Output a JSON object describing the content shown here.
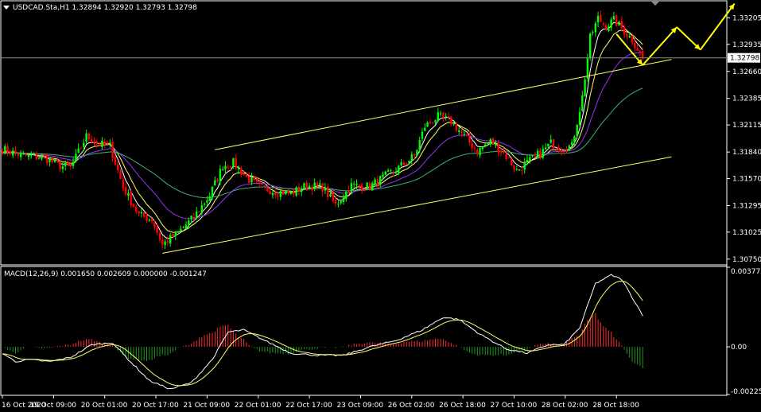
{
  "symbol_info": "USDCAD.Sta,H1  1.32894 1.32920 1.32793 1.32798",
  "current_price": "1.32798",
  "colors": {
    "background": "#000000",
    "bull": "#00ff00",
    "bear": "#ff0000",
    "ma_fast": "#ffffff",
    "ma_mid": "#ffff66",
    "ma_slow": "#9b30ff",
    "ma_long": "#3cb371",
    "channel": "#ffff66",
    "forecast": "#ffff00",
    "macd_hist_pos": "#ff2a2a",
    "macd_hist_neg": "#1f9a1f",
    "macd_main": "#ffffff",
    "macd_signal": "#ffff66",
    "price_marker_bg": "#ffffff",
    "price_marker_text": "#000000"
  },
  "chart_data": [
    {
      "type": "candlestick",
      "title": "USDCAD.Sta,H1  1.32894 1.32920 1.32793 1.32798",
      "x_ticks": [
        "16 Oct 2020",
        "19 Oct 09:00",
        "20 Oct 01:00",
        "20 Oct 17:00",
        "21 Oct 09:00",
        "22 Oct 01:00",
        "22 Oct 17:00",
        "23 Oct 09:00",
        "26 Oct 02:00",
        "26 Oct 18:00",
        "27 Oct 10:00",
        "28 Oct 02:00",
        "28 Oct 18:00"
      ],
      "y_ticks": [
        "1.33205",
        "1.32935",
        "1.32660",
        "1.32385",
        "1.32115",
        "1.31840",
        "1.31570",
        "1.31295",
        "1.31025",
        "1.30750"
      ],
      "ylim": [
        1.307,
        1.3337
      ],
      "last_price": 1.32798,
      "closes_anchor_points": [
        [
          0,
          1.3187
        ],
        [
          8,
          1.318
        ],
        [
          16,
          1.3178
        ],
        [
          22,
          1.317
        ],
        [
          26,
          1.3168
        ],
        [
          32,
          1.32
        ],
        [
          37,
          1.3192
        ],
        [
          41,
          1.319
        ],
        [
          46,
          1.3148
        ],
        [
          52,
          1.312
        ],
        [
          57,
          1.3115
        ],
        [
          61,
          1.309
        ],
        [
          67,
          1.3102
        ],
        [
          73,
          1.3118
        ],
        [
          79,
          1.314
        ],
        [
          84,
          1.317
        ],
        [
          88,
          1.3173
        ],
        [
          93,
          1.3158
        ],
        [
          98,
          1.3148
        ],
        [
          104,
          1.3144
        ],
        [
          110,
          1.3142
        ],
        [
          116,
          1.315
        ],
        [
          122,
          1.3148
        ],
        [
          127,
          1.313
        ],
        [
          133,
          1.315
        ],
        [
          140,
          1.3149
        ],
        [
          145,
          1.3158
        ],
        [
          151,
          1.3168
        ],
        [
          157,
          1.318
        ],
        [
          161,
          1.321
        ],
        [
          166,
          1.322
        ],
        [
          171,
          1.3215
        ],
        [
          176,
          1.32
        ],
        [
          181,
          1.3185
        ],
        [
          186,
          1.3195
        ],
        [
          191,
          1.3183
        ],
        [
          196,
          1.3165
        ],
        [
          201,
          1.3175
        ],
        [
          206,
          1.3185
        ],
        [
          209,
          1.3193
        ],
        [
          213,
          1.3188
        ],
        [
          217,
          1.319
        ],
        [
          221,
          1.324
        ],
        [
          224,
          1.33
        ],
        [
          227,
          1.332
        ],
        [
          230,
          1.3312
        ],
        [
          233,
          1.3318
        ],
        [
          236,
          1.331
        ],
        [
          240,
          1.3298
        ],
        [
          244,
          1.328
        ]
      ],
      "moving_averages": [
        {
          "name": "",
          "period": 5,
          "color_key": "ma_fast"
        },
        {
          "name": "",
          "period": 10,
          "color_key": "ma_mid"
        },
        {
          "name": "",
          "period": 24,
          "color_key": "ma_slow"
        },
        {
          "name": "",
          "period": 60,
          "color_key": "ma_long"
        }
      ],
      "channel": {
        "upper": [
          [
            81,
            1.31863
          ],
          [
            244,
            1.32724
          ]
        ],
        "upper_extended_to": [
          255,
          1.32781
        ],
        "lower": [
          [
            61,
            1.3081
          ],
          [
            255,
            1.3179
          ]
        ]
      },
      "forecast_arrows": [
        [
          [
            234,
            1.3304
          ],
          [
            244,
            1.32724
          ]
        ],
        [
          [
            244,
            1.32724
          ],
          [
            257,
            1.3311
          ]
        ],
        [
          [
            257,
            1.3311
          ],
          [
            266,
            1.3288
          ]
        ],
        [
          [
            266,
            1.3288
          ],
          [
            279,
            1.3335
          ]
        ]
      ]
    },
    {
      "type": "bar",
      "title": "MACD(12,26,9) 0.001650 0.002609 0.000000 -0.001247",
      "y_ticks": [
        "0.003772",
        "0.00",
        "-0.002257"
      ],
      "ylim": [
        -0.002257,
        0.003772
      ],
      "series_keys": [
        "histogram",
        "macd",
        "signal"
      ],
      "macd_anchor_points": [
        [
          0,
          -0.0003
        ],
        [
          5,
          -0.0007
        ],
        [
          10,
          -0.0006
        ],
        [
          18,
          -0.0007
        ],
        [
          26,
          -0.0005
        ],
        [
          34,
          0.0001
        ],
        [
          42,
          0.0002
        ],
        [
          48,
          -0.0006
        ],
        [
          56,
          -0.0016
        ],
        [
          64,
          -0.002
        ],
        [
          72,
          -0.0017
        ],
        [
          80,
          -0.0006
        ],
        [
          86,
          0.0007
        ],
        [
          92,
          0.0008
        ],
        [
          100,
          0.0003
        ],
        [
          110,
          -0.0003
        ],
        [
          120,
          -0.0004
        ],
        [
          130,
          -0.0004
        ],
        [
          140,
          0.0
        ],
        [
          150,
          0.0003
        ],
        [
          160,
          0.0008
        ],
        [
          168,
          0.0014
        ],
        [
          174,
          0.0013
        ],
        [
          182,
          0.0006
        ],
        [
          192,
          -0.0001
        ],
        [
          200,
          -0.0003
        ],
        [
          208,
          0.0001
        ],
        [
          214,
          0.0001
        ],
        [
          220,
          0.0009
        ],
        [
          226,
          0.003
        ],
        [
          232,
          0.0034
        ],
        [
          236,
          0.0032
        ],
        [
          244,
          0.0015
        ]
      ]
    }
  ]
}
